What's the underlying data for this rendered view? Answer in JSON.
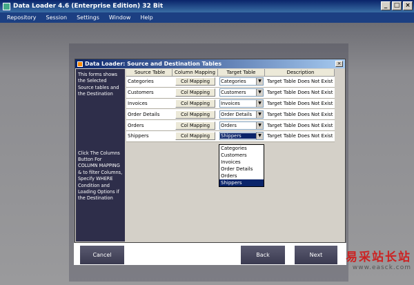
{
  "window": {
    "title": "Data Loader 4.6 (Enterprise Edition) 32 Bit"
  },
  "menu": [
    "Repository",
    "Session",
    "Settings",
    "Window",
    "Help"
  ],
  "dialog": {
    "title": "Data Loader: Source and Destination Tables",
    "side_text_1": "This forms shows the Selected Source tables and the Destination",
    "side_text_2": "Click The Columns Button For COLUMN MAPPING & to filter Columns, Specify WHERE Condition and Loading Options if the Destination",
    "headers": [
      "Source Table",
      "Column Mapping",
      "Target Table",
      "Description"
    ],
    "rows": [
      {
        "source": "Categories",
        "button": "Col Mapping",
        "target": "Categories",
        "description": "Target Table Does Not Exist"
      },
      {
        "source": "Customers",
        "button": "Col Mapping",
        "target": "Customers",
        "description": "Target Table Does Not Exist"
      },
      {
        "source": "Invoices",
        "button": "Col Mapping",
        "target": "Invoices",
        "description": "Target Table Does Not Exist"
      },
      {
        "source": "Order Details",
        "button": "Col Mapping",
        "target": "Order Details",
        "description": "Target Table Does Not Exist"
      },
      {
        "source": "Orders",
        "button": "Col Mapping",
        "target": "Orders",
        "description": "Target Table Does Not Exist"
      },
      {
        "source": "Shippers",
        "button": "Col Mapping",
        "target": "Shippers",
        "description": "Target Table Does Not Exist"
      }
    ],
    "dropdown_options": [
      "Categories",
      "Customers",
      "Invoices",
      "Order Details",
      "Orders",
      "Shippers"
    ]
  },
  "buttons": {
    "cancel": "Cancel",
    "back": "Back",
    "next": "Next"
  },
  "watermark": {
    "line1": "易采站长站",
    "line2": "www.easck.com"
  }
}
